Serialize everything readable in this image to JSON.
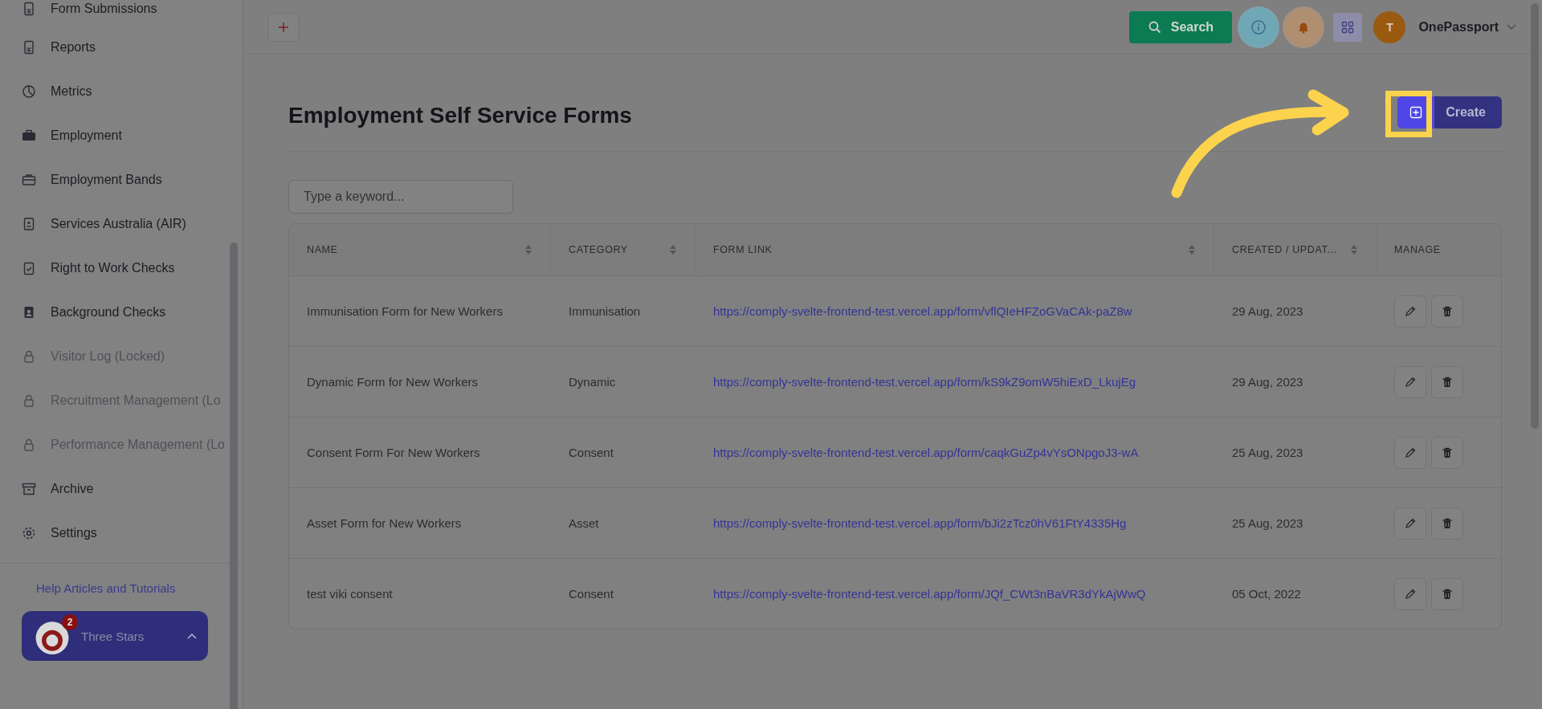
{
  "sidebar": {
    "items": [
      {
        "label": "Form Submissions",
        "locked": false
      },
      {
        "label": "Reports",
        "locked": false
      },
      {
        "label": "Metrics",
        "locked": false
      },
      {
        "label": "Employment",
        "locked": false
      },
      {
        "label": "Employment Bands",
        "locked": false
      },
      {
        "label": "Services Australia (AIR)",
        "locked": false
      },
      {
        "label": "Right to Work Checks",
        "locked": false
      },
      {
        "label": "Background Checks",
        "locked": false
      },
      {
        "label": "Visitor Log (Locked)",
        "locked": true
      },
      {
        "label": "Recruitment Management (Lo",
        "locked": true
      },
      {
        "label": "Performance Management (Lo",
        "locked": true
      },
      {
        "label": "Archive",
        "locked": false
      },
      {
        "label": "Settings",
        "locked": false
      }
    ],
    "help_link": "Help Articles and Tutorials",
    "account": {
      "name": "Three Stars",
      "badge": "2"
    }
  },
  "topbar": {
    "search_button": "Search",
    "avatar_letter": "T",
    "account_name": "OnePassport"
  },
  "page": {
    "title": "Employment Self Service Forms",
    "create_button": "Create"
  },
  "search": {
    "placeholder": "Type a keyword..."
  },
  "table": {
    "columns": [
      {
        "label": "NAME",
        "sortable": true
      },
      {
        "label": "CATEGORY",
        "sortable": true
      },
      {
        "label": "FORM LINK",
        "sortable": true
      },
      {
        "label": "CREATED / UPDAT...",
        "sortable": true
      },
      {
        "label": "MANAGE",
        "sortable": false
      }
    ],
    "rows": [
      {
        "name": "Immunisation Form for New Workers",
        "category": "Immunisation",
        "link": "https://comply-svelte-frontend-test.vercel.app/form/vflQIeHFZoGVaCAk-paZ8w",
        "date": "29 Aug, 2023"
      },
      {
        "name": "Dynamic Form for New Workers",
        "category": "Dynamic",
        "link": "https://comply-svelte-frontend-test.vercel.app/form/kS9kZ9omW5hiExD_LkujEg",
        "date": "29 Aug, 2023"
      },
      {
        "name": "Consent Form For New Workers",
        "category": "Consent",
        "link": "https://comply-svelte-frontend-test.vercel.app/form/caqkGuZp4vYsONpgoJ3-wA",
        "date": "25 Aug, 2023"
      },
      {
        "name": "Asset Form for New Workers",
        "category": "Asset",
        "link": "https://comply-svelte-frontend-test.vercel.app/form/bJi2zTcz0hV61FtY4335Hg",
        "date": "25 Aug, 2023"
      },
      {
        "name": "test viki consent",
        "category": "Consent",
        "link": "https://comply-svelte-frontend-test.vercel.app/form/JQf_CWt3nBaVR3dYkAjWwQ",
        "date": "05 Oct, 2022"
      }
    ]
  }
}
